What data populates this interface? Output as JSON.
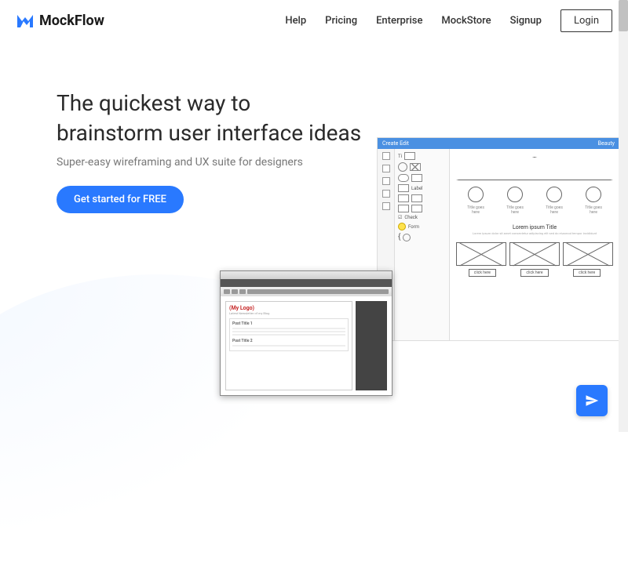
{
  "brand": {
    "name": "MockFlow"
  },
  "nav": {
    "help": "Help",
    "pricing": "Pricing",
    "enterprise": "Enterprise",
    "mockstore": "MockStore",
    "signup": "Signup",
    "login": "Login"
  },
  "hero": {
    "title_line1": "The quickest way to",
    "title_line2": "brainstorm user interface ideas",
    "subtitle": "Super-easy wireframing and UX suite for designers",
    "cta": "Get started for FREE"
  },
  "wireframe": {
    "toolbar_left": "Create Edit",
    "toolbar_right": "Beauty",
    "panel_text": "Ti",
    "panel_label": "Label",
    "panel_check": "Check",
    "panel_form": "Form",
    "circle_label": "Title goes here",
    "section_title": "Lorem ipsum Title",
    "lorem": "Lorem ipsum dolor sit amet consectetur adipiscing elit sed do eiusmod tempor incididunt",
    "btn_label": "click here"
  },
  "browser_mock": {
    "logo": "(My Logo)",
    "subtext": "Latest Newsletter of my Blog",
    "post1": "Post Title 1",
    "post2": "Post Title 2"
  }
}
